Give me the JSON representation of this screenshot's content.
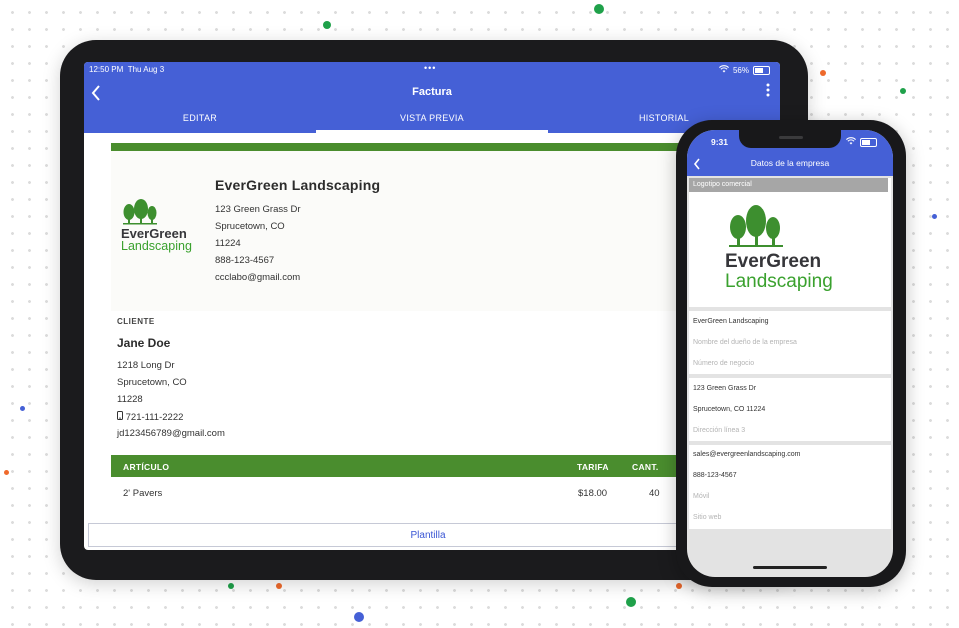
{
  "tablet": {
    "status": {
      "time": "12:50 PM",
      "date": "Thu Aug 3",
      "battery": "56%",
      "dots": "•••"
    },
    "nav": {
      "title": "Factura"
    },
    "tabs": [
      {
        "label": "EDITAR",
        "active": false
      },
      {
        "label": "VISTA PREVIA",
        "active": true
      },
      {
        "label": "HISTORIAL",
        "active": false
      }
    ],
    "invoice": {
      "company": {
        "logo_line1": "EverGreen",
        "logo_line2": "Landscaping",
        "name": "EverGreen Landscaping",
        "address1": "123 Green Grass Dr",
        "city": "Sprucetown, CO",
        "zip": "11224",
        "phone": "888-123-4567",
        "email": "ccclabo@gmail.com"
      },
      "client": {
        "label": "CLIENTE",
        "name": "Jane Doe",
        "address1": "1218 Long Dr",
        "city": "Sprucetown, CO",
        "zip": "11228",
        "phone": "721-111-2222",
        "email": "jd123456789@gmail.com"
      },
      "table": {
        "headers": {
          "item": "ARTÍCULO",
          "rate": "TARIFA",
          "qty": "CANT."
        },
        "rows": [
          {
            "item": "2' Pavers",
            "rate": "$18.00",
            "qty": "40"
          }
        ]
      }
    },
    "template_button": "Plantilla"
  },
  "phone": {
    "status": {
      "time": "9:31"
    },
    "nav": {
      "title": "Datos de la empresa"
    },
    "logo_section": {
      "header": "Logotipo comercial",
      "logo_line1": "EverGreen",
      "logo_line2": "Landscaping"
    },
    "fields": {
      "business_name": "EverGreen Landscaping",
      "owner_placeholder": "Nombre del dueño de la empresa",
      "number_placeholder": "Número de negocio",
      "address1": "123 Green Grass Dr",
      "address2": "Sprucetown, CO 11224",
      "address3_placeholder": "Dirección línea 3",
      "email": "sales@evergreenlandscaping.com",
      "phone": "888-123-4567",
      "mobile_placeholder": "Móvil",
      "website_placeholder": "Sitio web"
    }
  },
  "colors": {
    "brand_blue": "#4560d6",
    "invoice_green": "#4a8d2e",
    "logo_green": "#3aa12e"
  }
}
